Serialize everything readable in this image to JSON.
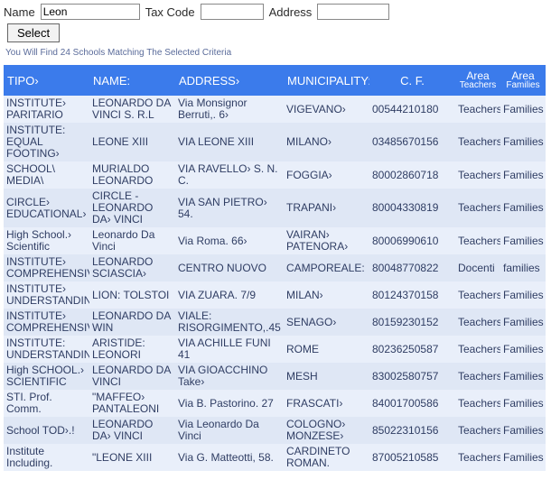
{
  "search": {
    "name_label": "Name",
    "name_value": "Leon",
    "tax_label": "Tax Code",
    "tax_value": "",
    "addr_label": "Address",
    "addr_value": "",
    "select_label": "Select"
  },
  "result_note": "You Will Find 24 Schools Matching The Selected Criteria",
  "headers": {
    "tipo": "TIPO›",
    "name": "NAME:",
    "address": "ADDRESS›",
    "municipality": "MUNICIPALITY:",
    "cf": "C. F.",
    "area_top": "Area",
    "area1_sub": "Teachers",
    "area2_sub": "Families"
  },
  "rows": [
    {
      "tipo": "INSTITUTE› PARITARIO",
      "name": "LEONARDO DA VINCI S. R.L",
      "addr": "Via Monsignor Berruti,. 6›",
      "muni": "VIGEVANO›",
      "cf": "00544210180",
      "a1": "Teachers",
      "a2": "Families"
    },
    {
      "tipo": "INSTITUTE: EQUAL FOOTING›",
      "name": "LEONE XIII",
      "addr": "VIA LEONE XIII",
      "muni": "MILANO›",
      "cf": "03485670156",
      "a1": "Teachers",
      "a2": "Families"
    },
    {
      "tipo": "SCHOOL\\ MEDIA\\",
      "name": "MURIALDO LEONARDO",
      "addr": "VIA RAVELLO› S. N. C.",
      "muni": "FOGGIA›",
      "cf": "80002860718",
      "a1": "Teachers",
      "a2": "Families"
    },
    {
      "tipo": "CIRCLE› EDUCATIONAL›",
      "name": "CIRCLE - LEONARDO DA› VINCI",
      "addr": "VIA SAN PIETRO› 54.",
      "muni": "TRAPANI›",
      "cf": "80004330819",
      "a1": "Teachers",
      "a2": "Families"
    },
    {
      "tipo": "High School.› Scientific",
      "name": "Leonardo Da Vinci",
      "addr": "Via Roma. 66›",
      "muni": "VAIRAN› PATENORA›",
      "cf": "80006990610",
      "a1": "Teachers",
      "a2": "Families"
    },
    {
      "tipo": "INSTITUTE› COMPREHENSIVE",
      "name": "LEONARDO SCIASCIA›",
      "addr": "CENTRO NUOVO",
      "muni": "CAMPOREALE:",
      "cf": "80048770822",
      "a1": "Docenti",
      "a2": "families"
    },
    {
      "tipo": "INSTITUTE› UNDERSTANDING",
      "name": "LION: TOLSTOI",
      "addr": "VIA ZUARA. 7/9",
      "muni": "MILAN›",
      "cf": "80124370158",
      "a1": "Teachers",
      "a2": "Families"
    },
    {
      "tipo": "INSTITUTE› COMPREHENSIVE",
      "name": "LEONARDO DA WIN",
      "addr": "VIALE: RISORGIMENTO,.45",
      "muni": "SENAGO›",
      "cf": "80159230152",
      "a1": "Teachers",
      "a2": "Families"
    },
    {
      "tipo": "INSTITUTE: UNDERSTANDING",
      "name": "ARISTIDE: LEONORI",
      "addr": "VIA ACHILLE FUNI 41",
      "muni": "ROME",
      "cf": "80236250587",
      "a1": "Teachers",
      "a2": "Families"
    },
    {
      "tipo": "High SCHOOL.› SCIENTIFIC",
      "name": "LEONARDO DA VINCI",
      "addr": "VIA GIOACCHINO Take›",
      "muni": "MESH",
      "cf": "83002580757",
      "a1": "Teachers",
      "a2": "Families"
    },
    {
      "tipo": "STI. Prof. Comm.",
      "name": "\"MAFFEO› PANTALEONI",
      "addr": "Via B. Pastorino. 27",
      "muni": "FRASCATI›",
      "cf": "84001700586",
      "a1": "Teachers",
      "a2": "Families"
    },
    {
      "tipo": "School TOD›.!",
      "name": "LEONARDO DA› VINCI",
      "addr": "Via Leonardo Da Vinci",
      "muni": "COLOGNO› MONZESE›",
      "cf": "85022310156",
      "a1": "Teachers",
      "a2": "Families"
    },
    {
      "tipo": "Institute Including.",
      "name": "\"LEONE XIII",
      "addr": "Via G. Matteotti, 58.",
      "muni": "CARDINETO ROMAN.",
      "cf": "87005210585",
      "a1": "Teachers",
      "a2": "Families"
    }
  ]
}
